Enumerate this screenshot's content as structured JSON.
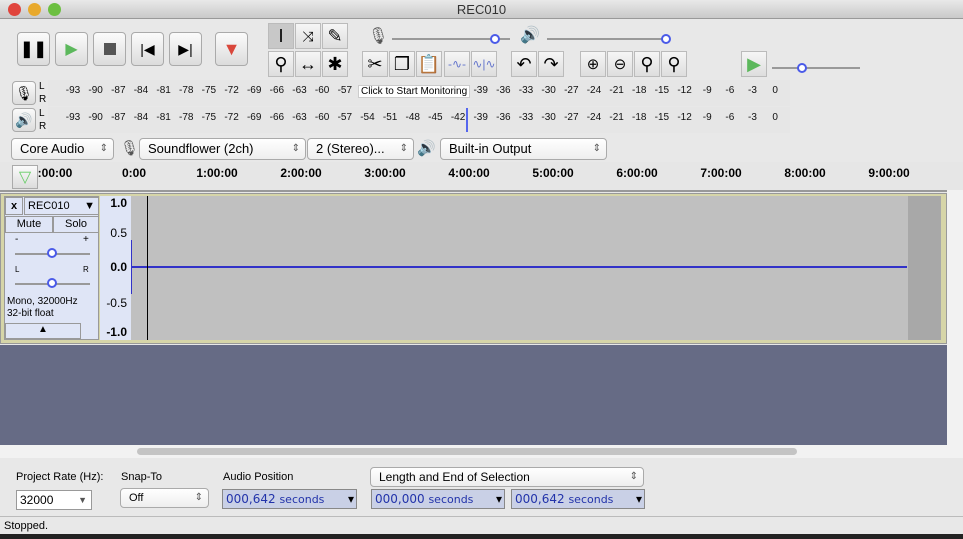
{
  "window": {
    "title": "REC010"
  },
  "transport": {
    "buttons": [
      "pause",
      "play",
      "stop",
      "skip-to-start",
      "skip-to-end",
      "record"
    ]
  },
  "tools": {
    "buttons": [
      "selection-tool",
      "envelope-tool",
      "draw-tool",
      "zoom-tool",
      "timeshift-tool",
      "multi-tool"
    ]
  },
  "mixer": {
    "input_volume": 0.88,
    "output_volume": 1.0,
    "minus": "-",
    "plus": "+"
  },
  "edit": {
    "buttons": [
      "cut",
      "copy",
      "paste",
      "trim",
      "silence",
      "undo",
      "redo",
      "zoom-in",
      "zoom-out",
      "fit-selection",
      "fit-project"
    ]
  },
  "play_at_speed": {
    "speed": 0.3,
    "minus": "-",
    "plus": "+"
  },
  "meters": {
    "ticks": [
      "-93",
      "-90",
      "-87",
      "-84",
      "-81",
      "-78",
      "-75",
      "-72",
      "-69",
      "-66",
      "-63",
      "-60",
      "-57",
      "-54",
      "-51",
      "-48",
      "-45",
      "-42",
      "-39",
      "-36",
      "-33",
      "-30",
      "-27",
      "-24",
      "-21",
      "-18",
      "-15",
      "-12",
      "-9",
      "-6",
      "-3",
      "0"
    ],
    "channel_l": "L",
    "channel_r": "R",
    "record_tooltip": "Click to Start Monitoring",
    "playback_peak_db": -42
  },
  "devices": {
    "host": "Core Audio",
    "input": "Soundflower (2ch)",
    "channels": "2 (Stereo)...",
    "output": "Built-in Output"
  },
  "ruler": {
    "labels": [
      ":00:00",
      "0:00",
      "1:00:00",
      "2:00:00",
      "3:00:00",
      "4:00:00",
      "5:00:00",
      "6:00:00",
      "7:00:00",
      "8:00:00",
      "9:00:00"
    ]
  },
  "track": {
    "name": "REC010",
    "close": "x",
    "mute": "Mute",
    "solo": "Solo",
    "gain_minus": "-",
    "gain_plus": "+",
    "pan_l": "L",
    "pan_r": "R",
    "gain": 0.5,
    "pan": 0.5,
    "info1": "Mono, 32000Hz",
    "info2": "32-bit float",
    "scale": [
      "1.0",
      "0.5",
      "0.0",
      "-0.5",
      "-1.0"
    ],
    "wave_color": "#3232c8"
  },
  "selection_bar": {
    "project_rate_label": "Project Rate (Hz):",
    "project_rate": "32000",
    "snap_label": "Snap-To",
    "snap_value": "Off",
    "audio_position_label": "Audio Position",
    "audio_position": "000,642",
    "unit": "seconds",
    "selection_mode": "Length and End of Selection",
    "selection_start": "000,000",
    "selection_end": "000,642"
  },
  "status": {
    "text": "Stopped."
  }
}
